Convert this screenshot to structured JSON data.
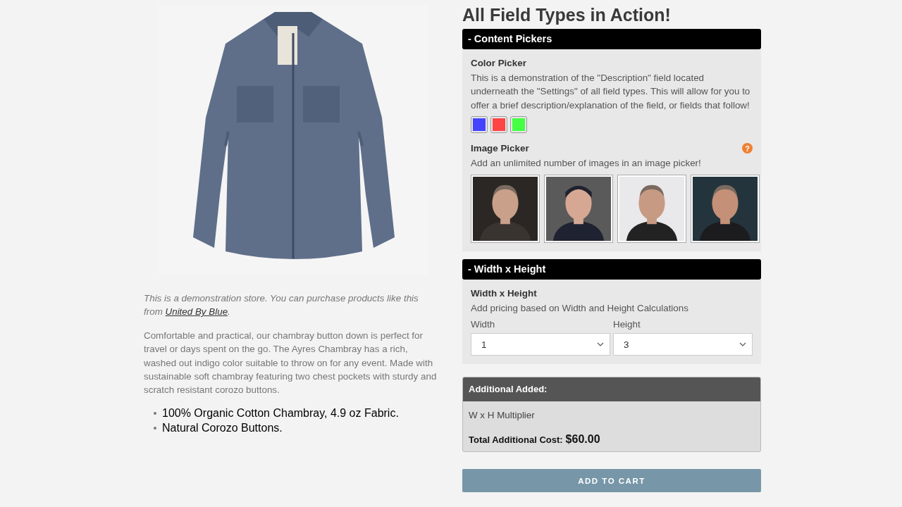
{
  "product": {
    "image": {
      "kind": "picture"
    },
    "note": {
      "text_before": "This is a demonstration store. You can purchase products like this from ",
      "link": "United By Blue",
      "text_after": "."
    },
    "description": "Comfortable and practical, our chambray button down is perfect for travel or days spent on the go. The Ayres Chambray has a rich, washed out indigo color suitable to throw on for any event. Made with sustainable soft chambray featuring two chest pockets with sturdy and scratch resistant corozo buttons.",
    "features": [
      "100% Organic Cotton Chambray, 4.9 oz Fabric.",
      "Natural Corozo Buttons."
    ]
  },
  "options": {
    "title": "All Field Types in Action!",
    "sections": [
      {
        "header": "- Content Pickers",
        "fields": [
          {
            "kind": "colors",
            "label": "Color Picker",
            "description": "This is a demonstration of the \"Description\" field located underneath the \"Settings\" of all field types. This will allow for you to offer a brief description/explanation of the field, or fields that follow!",
            "swatches": [
              {
                "color": "#4444ff"
              },
              {
                "color": "#ff4444"
              },
              {
                "color": "#44ff44"
              }
            ]
          },
          {
            "kind": "images",
            "label": "Image Picker",
            "help": "?",
            "description": "Add an unlimited number of images in an image picker!",
            "images": [
              {
                "kind": "picture"
              },
              {
                "kind": "picture"
              },
              {
                "kind": "picture"
              },
              {
                "kind": "picture"
              }
            ]
          }
        ]
      },
      {
        "header": "- Width x Height",
        "fields": [
          {
            "kind": "dimensions",
            "label": "Width x Height",
            "description": "Add pricing based on Width and Height Calculations",
            "selects": [
              {
                "label": "Width",
                "value": "1"
              },
              {
                "label": "Height",
                "value": "3"
              }
            ]
          }
        ]
      }
    ],
    "summary": {
      "header": "Additional Added:",
      "line": "W x H Multiplier",
      "total_label": "Total Additional Cost:",
      "total_value": "$60.00"
    },
    "button": "ADD TO CART"
  }
}
